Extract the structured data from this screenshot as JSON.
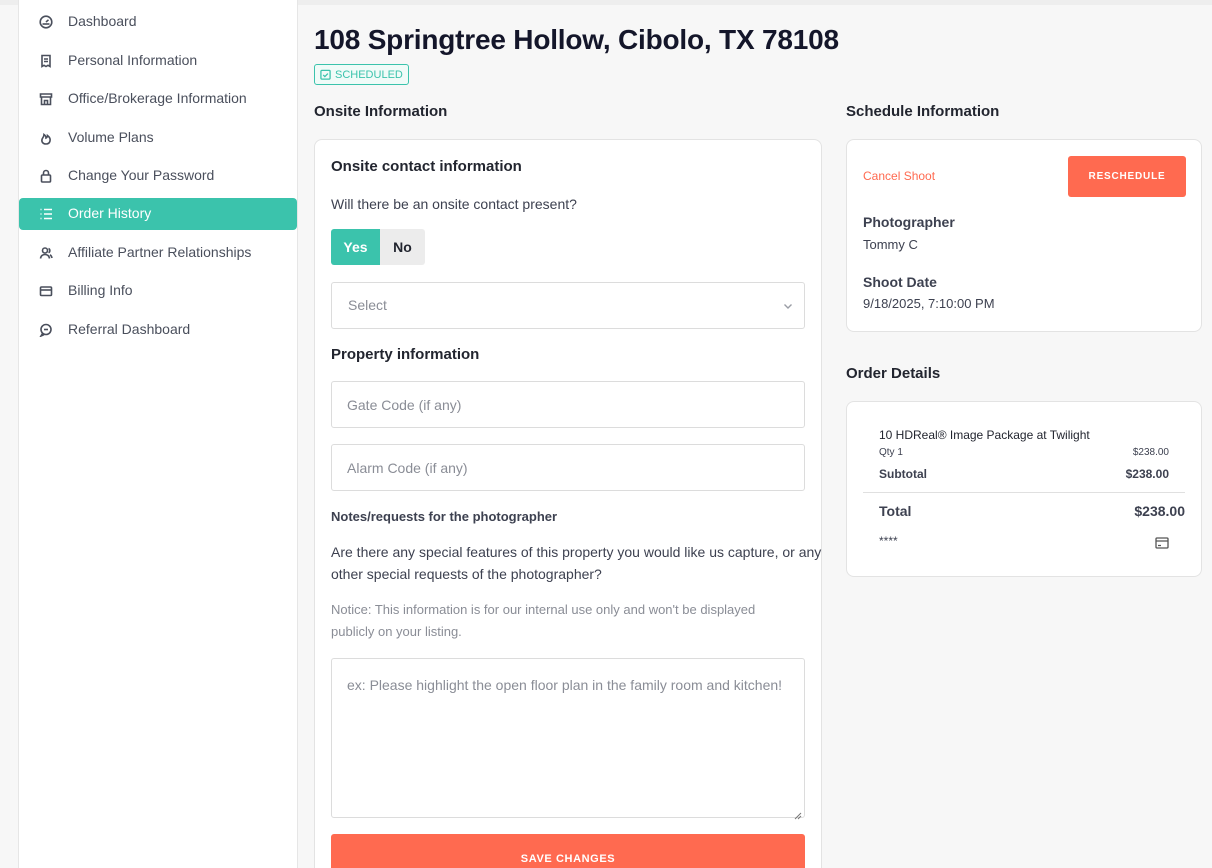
{
  "sidebar": {
    "items": [
      {
        "label": "Dashboard",
        "icon": "gauge-icon"
      },
      {
        "label": "Personal Information",
        "icon": "document-icon"
      },
      {
        "label": "Office/Brokerage Information",
        "icon": "building-icon"
      },
      {
        "label": "Volume Plans",
        "icon": "flame-icon"
      },
      {
        "label": "Change Your Password",
        "icon": "lock-icon"
      },
      {
        "label": "Order History",
        "icon": "list-icon",
        "active": true
      },
      {
        "label": "Affiliate Partner Relationships",
        "icon": "users-icon"
      },
      {
        "label": "Billing Info",
        "icon": "wallet-icon"
      },
      {
        "label": "Referral Dashboard",
        "icon": "chat-icon"
      }
    ]
  },
  "page": {
    "title": "108 Springtree Hollow, Cibolo, TX 78108",
    "status": "SCHEDULED"
  },
  "onsite": {
    "section_title": "Onsite Information",
    "contact_heading": "Onsite contact information",
    "contact_question": "Will there be an onsite contact present?",
    "yes_label": "Yes",
    "no_label": "No",
    "select_placeholder": "Select",
    "property_heading": "Property information",
    "gate_placeholder": "Gate Code (if any)",
    "alarm_placeholder": "Alarm Code (if any)",
    "notes_heading": "Notes/requests for the photographer",
    "notes_question_line1": "Are there any special features of this property you would like us capture, or any",
    "notes_question_line2": "other special requests of the photographer?",
    "notice_line1": "Notice: This information is for our internal use only and won't be displayed",
    "notice_line2": "publicly on your listing.",
    "notes_placeholder": "ex: Please highlight the open floor plan in the family room and kitchen!",
    "save_label": "SAVE CHANGES"
  },
  "schedule": {
    "section_title": "Schedule Information",
    "cancel_label": "Cancel Shoot",
    "reschedule_label": "RESCHEDULE",
    "photographer_label": "Photographer",
    "photographer_value": "Tommy C",
    "shoot_date_label": "Shoot Date",
    "shoot_date_value": "9/18/2025, 7:10:00 PM"
  },
  "order": {
    "section_title": "Order Details",
    "item_name": "10 HDReal® Image Package at Twilight",
    "qty": "Qty 1",
    "item_price": "$238.00",
    "subtotal_label": "Subtotal",
    "subtotal_value": "$238.00",
    "total_label": "Total",
    "total_value": "$238.00",
    "card_mask": "****"
  },
  "colors": {
    "accent": "#3bc3ac",
    "action": "#ff6a50"
  }
}
